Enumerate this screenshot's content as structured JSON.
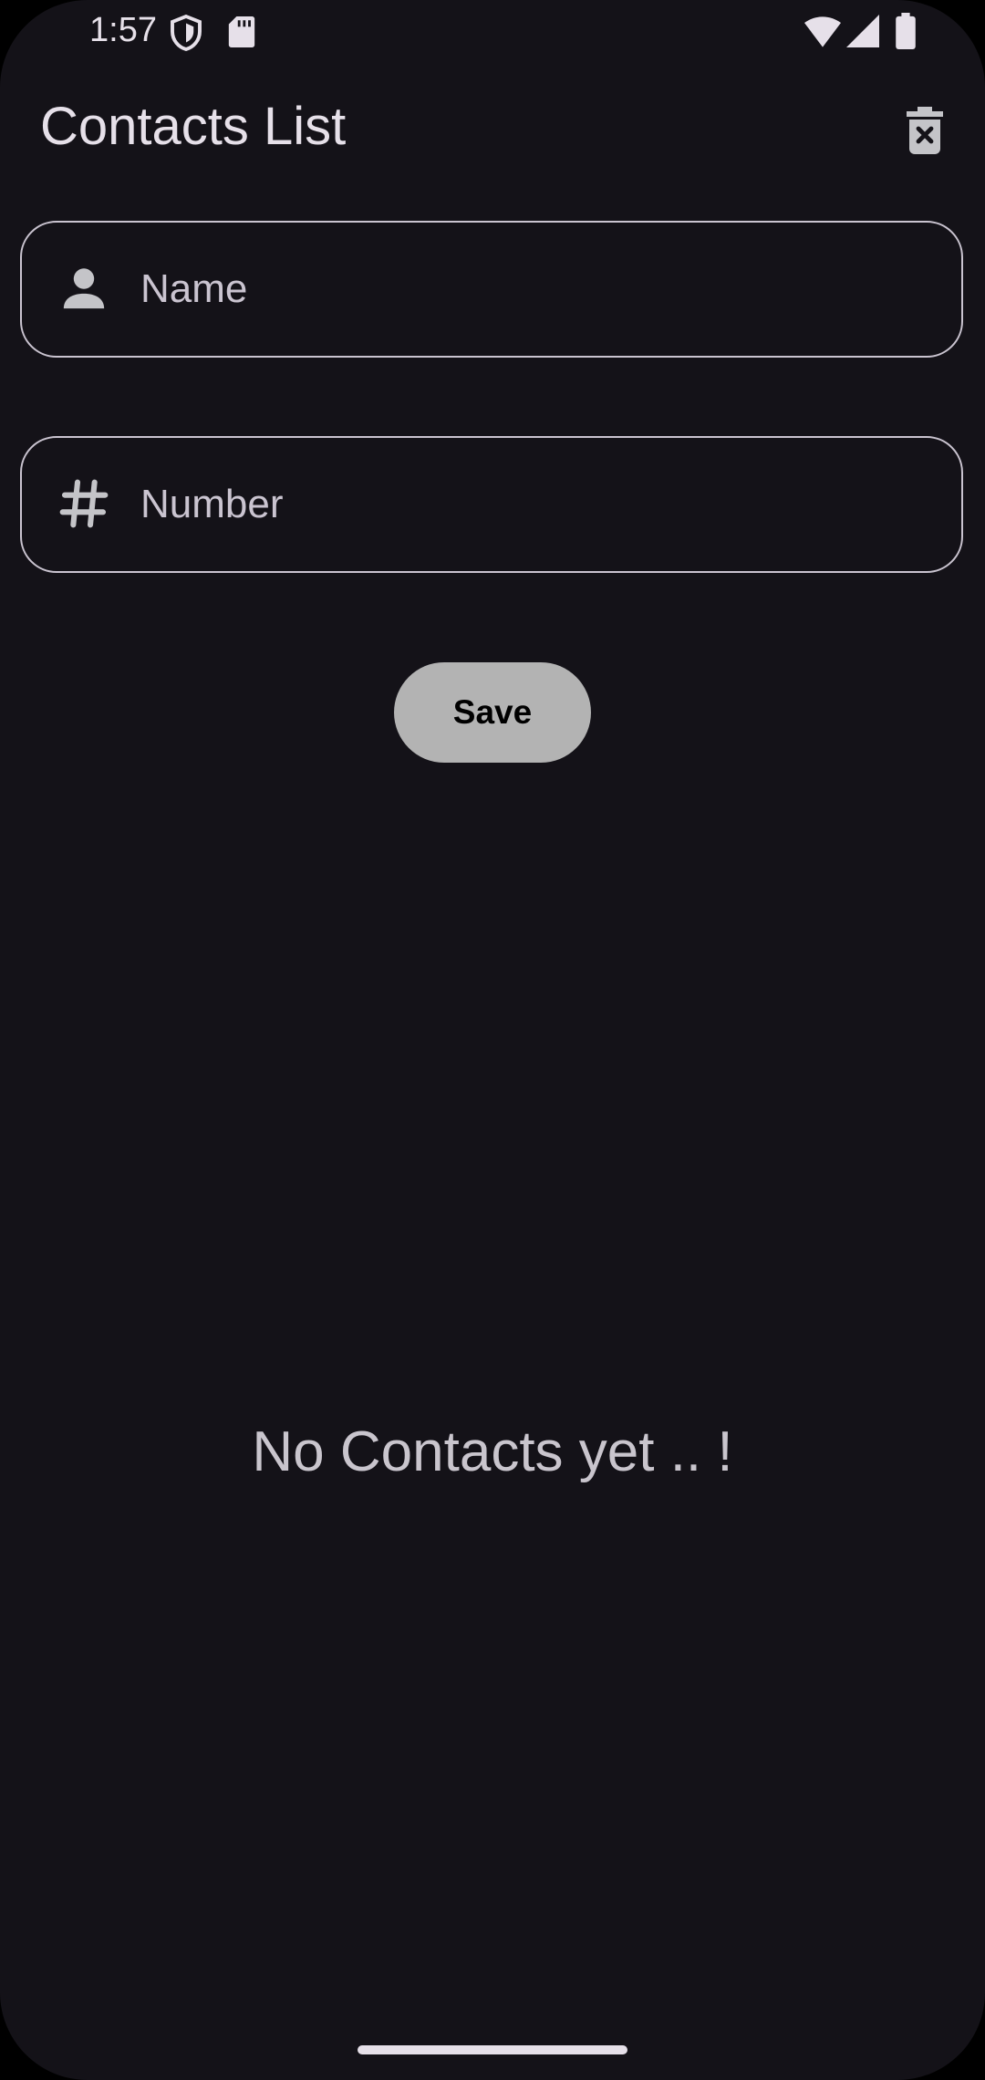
{
  "status_bar": {
    "time": "1:57",
    "icons": [
      "shield-icon",
      "sd-card-icon",
      "wifi-icon",
      "signal-icon",
      "battery-icon"
    ]
  },
  "app_bar": {
    "title": "Contacts List",
    "action_icon": "delete-forever-icon"
  },
  "form": {
    "name_field": {
      "icon": "person-icon",
      "placeholder": "Name",
      "value": ""
    },
    "number_field": {
      "icon": "hash-icon",
      "placeholder": "Number",
      "value": ""
    },
    "save_label": "Save"
  },
  "empty_state": {
    "message": "No Contacts yet .. !"
  },
  "colors": {
    "background": "#141218",
    "text_primary": "#E6E0E9",
    "outline": "#CAC4D0",
    "button_fill": "#B3B3B3",
    "icon": "#C4C4C8"
  }
}
